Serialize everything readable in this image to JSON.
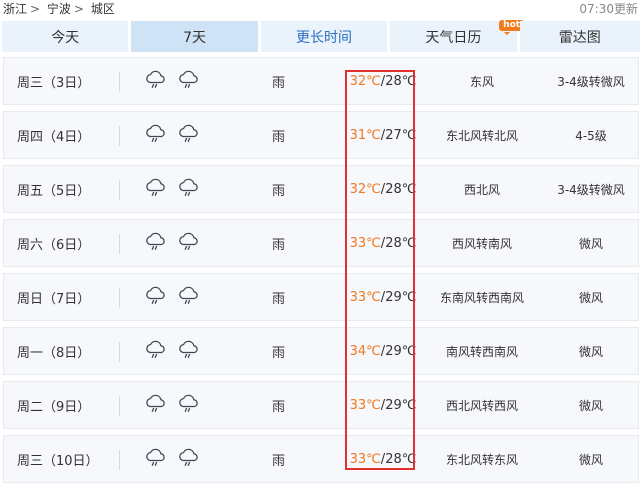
{
  "breadcrumb": {
    "province": "浙江",
    "city": "宁波",
    "district": "城区",
    "separator": ">"
  },
  "updated": "07:30更新",
  "tabs": [
    {
      "label": "今天"
    },
    {
      "label": "7天"
    },
    {
      "label": "更长时间"
    },
    {
      "label": "天气日历",
      "badge": "hot"
    },
    {
      "label": "雷达图"
    }
  ],
  "forecast": [
    {
      "day": "周三（3日）",
      "icons": [
        "rain-cloud-icon",
        "rain-cloud-icon"
      ],
      "desc": "雨",
      "high": "32℃",
      "low": "28℃",
      "wind": "东风",
      "level": "3-4级转微风"
    },
    {
      "day": "周四（4日）",
      "icons": [
        "rain-cloud-icon",
        "rain-cloud-icon"
      ],
      "desc": "雨",
      "high": "31℃",
      "low": "27℃",
      "wind": "东北风转北风",
      "level": "4-5级"
    },
    {
      "day": "周五（5日）",
      "icons": [
        "rain-cloud-icon",
        "rain-cloud-icon"
      ],
      "desc": "雨",
      "high": "32℃",
      "low": "28℃",
      "wind": "西北风",
      "level": "3-4级转微风"
    },
    {
      "day": "周六（6日）",
      "icons": [
        "rain-cloud-icon",
        "rain-cloud-icon"
      ],
      "desc": "雨",
      "high": "33℃",
      "low": "28℃",
      "wind": "西风转南风",
      "level": "微风"
    },
    {
      "day": "周日（7日）",
      "icons": [
        "rain-cloud-icon",
        "rain-cloud-icon"
      ],
      "desc": "雨",
      "high": "33℃",
      "low": "29℃",
      "wind": "东南风转西南风",
      "level": "微风"
    },
    {
      "day": "周一（8日）",
      "icons": [
        "rain-cloud-icon",
        "rain-cloud-icon"
      ],
      "desc": "雨",
      "high": "34℃",
      "low": "29℃",
      "wind": "南风转西南风",
      "level": "微风"
    },
    {
      "day": "周二（9日）",
      "icons": [
        "rain-cloud-icon",
        "rain-cloud-icon"
      ],
      "desc": "雨",
      "high": "33℃",
      "low": "29℃",
      "wind": "西北风转西风",
      "level": "微风"
    },
    {
      "day": "周三（10日）",
      "icons": [
        "rain-cloud-icon",
        "rain-cloud-icon"
      ],
      "desc": "雨",
      "high": "33℃",
      "low": "28℃",
      "wind": "东北风转东风",
      "level": "微风"
    }
  ],
  "colors": {
    "high_temp": "#f0781e",
    "highlight_border": "#e03030",
    "tab_active": "#cfe3f7",
    "tab": "#eaf2fb",
    "link": "#2b6fc0"
  }
}
